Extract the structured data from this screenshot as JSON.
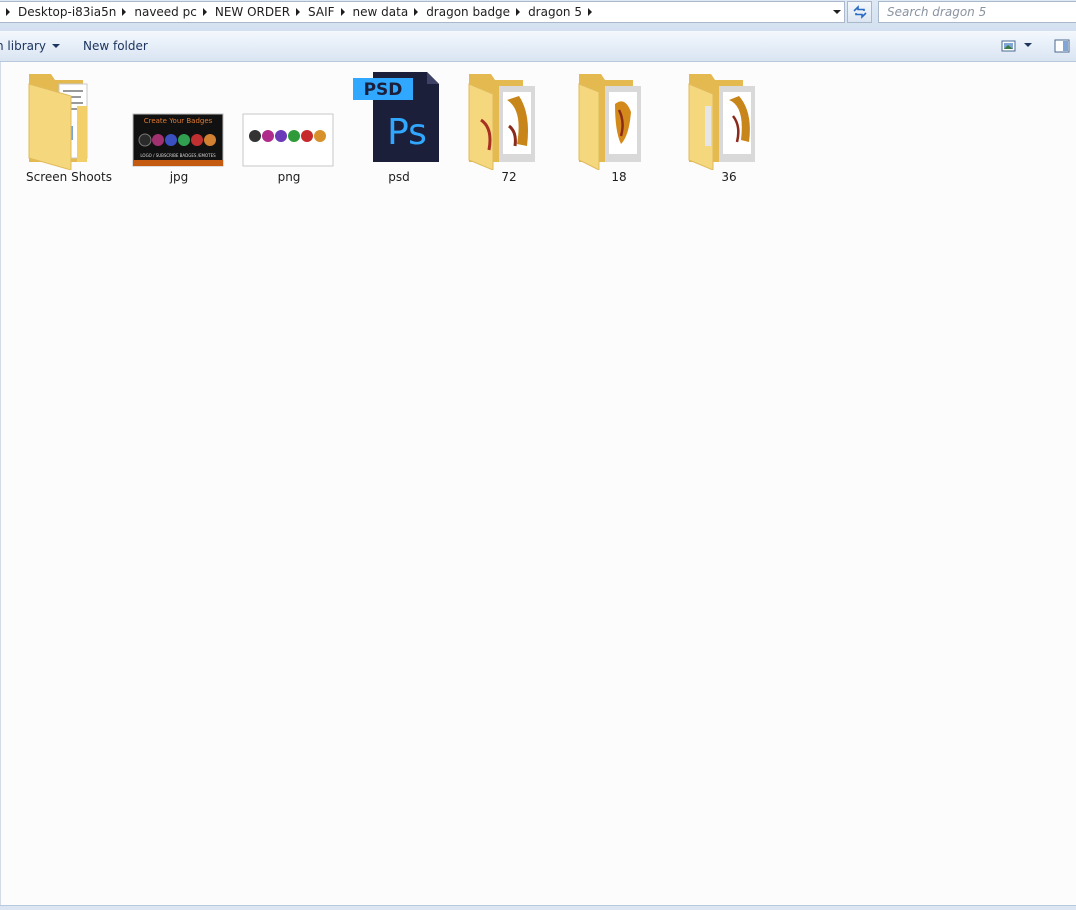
{
  "address_bar": {
    "breadcrumbs": [
      {
        "label": "Desktop-i83ia5n"
      },
      {
        "label": "naveed pc"
      },
      {
        "label": "NEW ORDER"
      },
      {
        "label": "SAIF"
      },
      {
        "label": "new data"
      },
      {
        "label": "dragon badge"
      },
      {
        "label": "dragon 5"
      }
    ]
  },
  "search": {
    "placeholder": "Search dragon 5"
  },
  "toolbar": {
    "include_label": "n library",
    "new_folder_label": "New folder"
  },
  "items": [
    {
      "label": "Screen Shoots",
      "kind": "folder-icon"
    },
    {
      "label": "jpg",
      "kind": "image-thumbnail",
      "thumb_text_top": "Create Your Badges",
      "thumb_text_bottom": "LOGO / SUBSCRIBE BADGES /EMOTES"
    },
    {
      "label": "png",
      "kind": "image-thumbnail"
    },
    {
      "label": "psd",
      "kind": "photoshop-file-icon",
      "badge_text": "PSD",
      "logo_text": "Ps"
    },
    {
      "label": "72",
      "kind": "folder-icon"
    },
    {
      "label": "18",
      "kind": "folder-icon"
    },
    {
      "label": "36",
      "kind": "folder-icon"
    }
  ],
  "colors": {
    "folder": "#f5d77e",
    "folder_dark": "#e4b94f",
    "psd_bg": "#1c1f3a",
    "psd_accent": "#31a8ff"
  }
}
